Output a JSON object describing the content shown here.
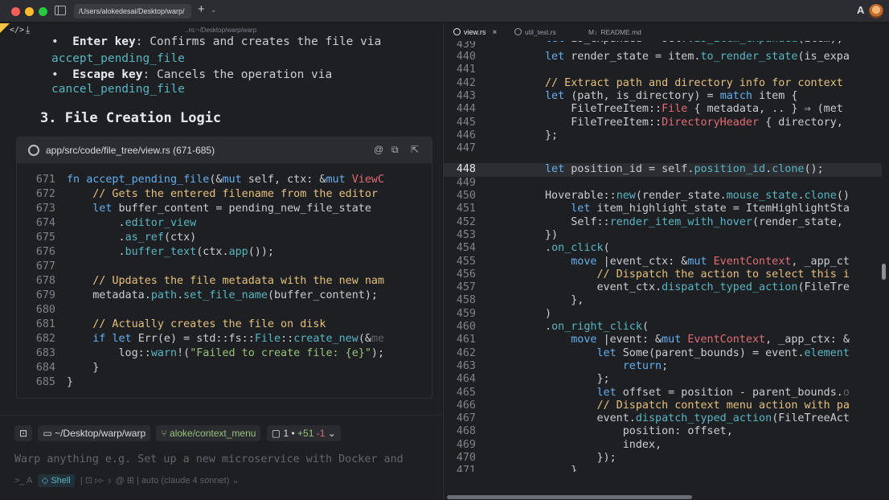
{
  "window": {
    "tab_title": "/Users/alokedesai/Desktop/warp/",
    "new_tab": "+",
    "tab_dropdown": "⌄",
    "font_indicator": "A"
  },
  "left": {
    "header": {
      "code_toggle": "</>",
      "download": "⤓",
      "path": "..ro:~/Desktop/warp/warp"
    },
    "markdown": {
      "line1_bullet": "•",
      "line1_bold": "Enter key",
      "line1_text": ": Confirms and creates the file via",
      "line2_code": "accept_pending_file",
      "line3_bullet": "•",
      "line3_bold": "Escape key",
      "line3_text": ": Cancels the operation via",
      "line4_code": "cancel_pending_file",
      "heading": "3. File Creation Logic"
    },
    "code_card": {
      "title": "app/src/code/file_tree/view.rs (671-685)",
      "lines": [
        "671",
        "672",
        "673",
        "674",
        "675",
        "676",
        "677",
        "678",
        "679",
        "680",
        "681",
        "682",
        "683",
        "684",
        "685"
      ]
    },
    "input": {
      "ctx_dir": "~/Desktop/warp/warp",
      "branch": "aloke/context_menu",
      "changes_files": "1",
      "changes_plus": "+51",
      "changes_minus": "-1",
      "placeholder": "Warp anything e.g. Set up a new microservice with Docker and",
      "shell_label": "Shell",
      "model": "auto (claude 4 sonnet)"
    }
  },
  "right": {
    "tabs": [
      {
        "label": "view.rs"
      },
      {
        "label": "util_test.rs"
      },
      {
        "label": "README.md"
      }
    ],
    "close": "×",
    "line_numbers": [
      "439",
      "440",
      "441",
      "442",
      "443",
      "444",
      "445",
      "446",
      "447",
      "448",
      "449",
      "450",
      "451",
      "452",
      "453",
      "454",
      "455",
      "456",
      "457",
      "458",
      "459",
      "460",
      "461",
      "462",
      "463",
      "464",
      "465",
      "466",
      "467",
      "468",
      "469",
      "470",
      "471"
    ]
  },
  "colors": {
    "keyword": "#61afef",
    "type": "#e06c75",
    "comment": "#e5c07b",
    "string": "#98c379",
    "method": "#56b6c2",
    "background": "#1e1f23"
  }
}
